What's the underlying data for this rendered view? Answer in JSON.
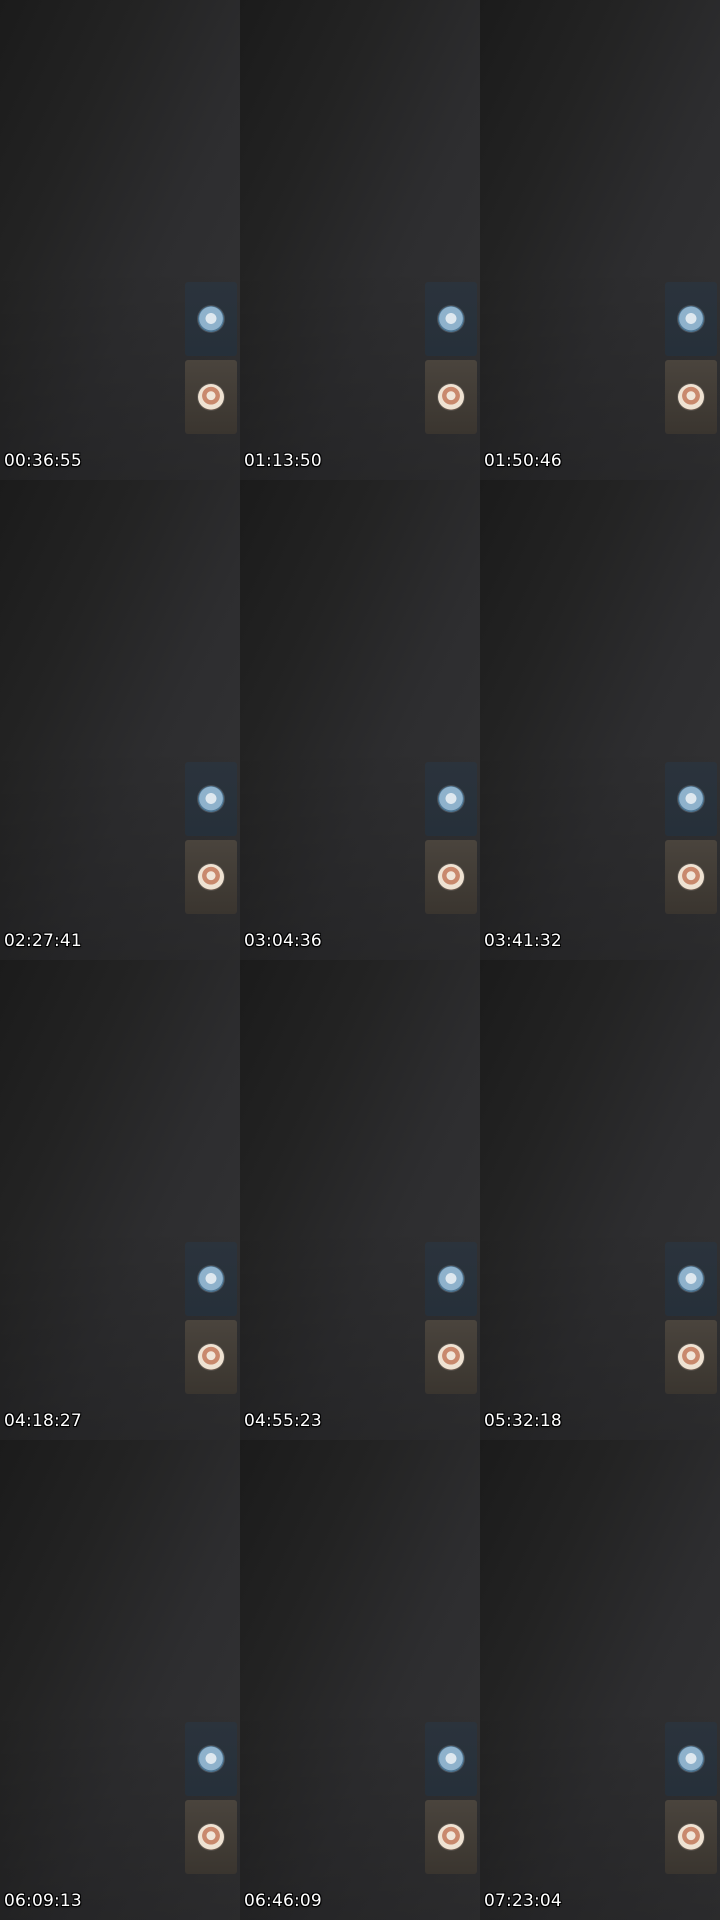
{
  "frames": [
    {
      "timestamp": "00:36:55"
    },
    {
      "timestamp": "01:13:50"
    },
    {
      "timestamp": "01:50:46"
    },
    {
      "timestamp": "02:27:41"
    },
    {
      "timestamp": "03:04:36"
    },
    {
      "timestamp": "03:41:32"
    },
    {
      "timestamp": "04:18:27"
    },
    {
      "timestamp": "04:55:23"
    },
    {
      "timestamp": "05:32:18"
    },
    {
      "timestamp": "06:09:13"
    },
    {
      "timestamp": "06:46:09"
    },
    {
      "timestamp": "07:23:04"
    }
  ],
  "colors": {
    "background_dark": "#1b1b1b",
    "background_light": "#343436",
    "card_1": "#2b333c",
    "card_2": "#4a443d",
    "timestamp_text": "#ffffff"
  },
  "icons": {
    "avatar_1": "participant-avatar-blue",
    "avatar_2": "participant-avatar-warm"
  }
}
